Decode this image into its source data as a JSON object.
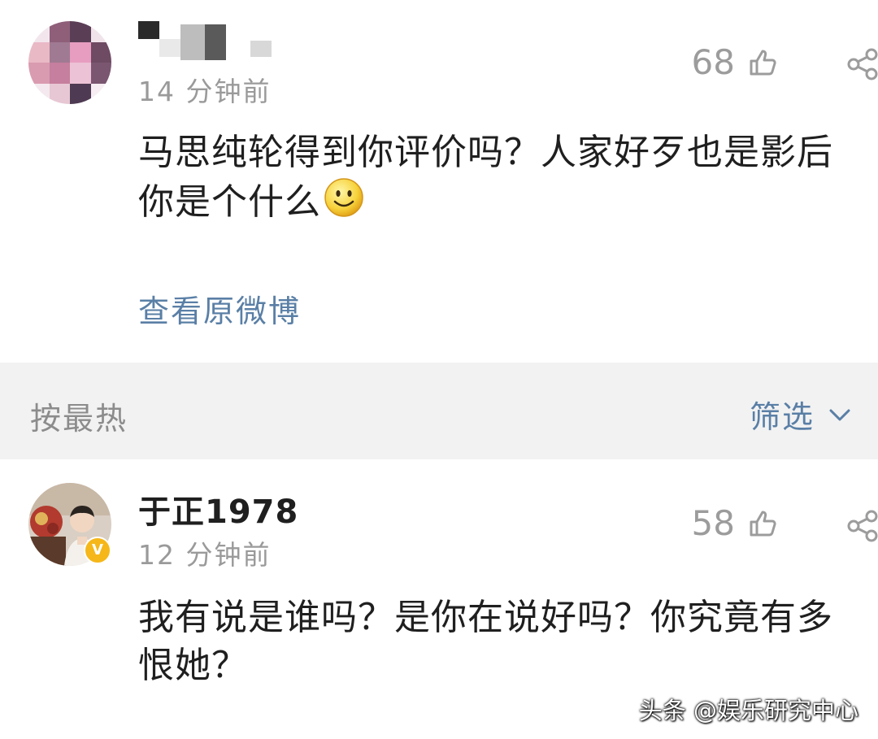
{
  "comment1": {
    "time": "14 分钟前",
    "likes": "68",
    "text": "马思纯轮得到你评价吗？人家好歹也是影后你是个什么",
    "link": "查看原微博",
    "emoji": "smile-emoji"
  },
  "filter_bar": {
    "sort": "按最热",
    "filter": "筛选"
  },
  "comment2": {
    "username": "于正1978",
    "time": "12 分钟前",
    "likes": "58",
    "text": "我有说是谁吗？是你在说好吗？你究竟有多恨她？",
    "verified": "V"
  },
  "watermark": "头条 @娱乐研究中心",
  "colors": {
    "link": "#5a7fa6",
    "meta": "#9a9a9a",
    "text": "#1f1f1f",
    "filter_bg": "#f2f2f2",
    "badge": "#f5b719"
  },
  "icons": [
    "like-icon",
    "share-icon",
    "chevron-down-icon",
    "smile-emoji",
    "verified-badge"
  ]
}
